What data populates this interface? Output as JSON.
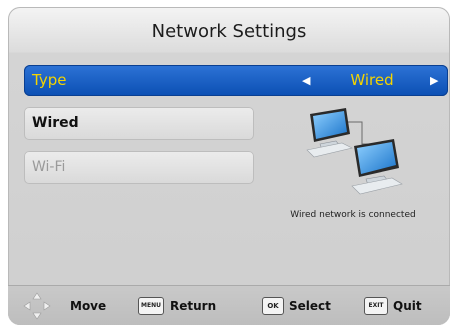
{
  "title": "Network Settings",
  "type_row": {
    "label": "Type",
    "value": "Wired"
  },
  "options": [
    {
      "label": "Wired"
    },
    {
      "label": "Wi-Fi"
    }
  ],
  "status_text": "Wired network is connected",
  "footer": {
    "move": "Move",
    "menu_key": "MENU",
    "return": "Return",
    "ok_key": "OK",
    "select": "Select",
    "exit_key": "EXIT",
    "quit": "Quit"
  },
  "colors": {
    "highlight_bg": "#1560c8",
    "highlight_text": "#f4d400"
  },
  "icons": {
    "network": "two-connected-monitors-icon",
    "dpad": "directional-pad-icon",
    "arrow_left": "arrow-left-icon",
    "arrow_right": "arrow-right-icon"
  }
}
